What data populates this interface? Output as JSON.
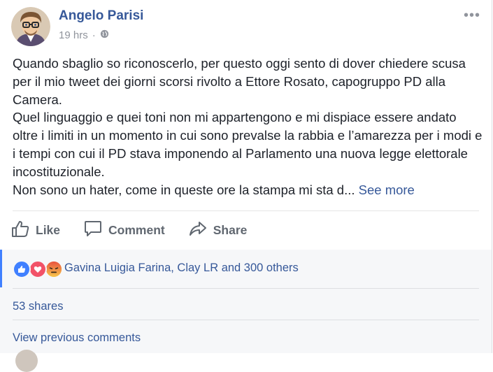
{
  "post": {
    "author": "Angelo Parisi",
    "time": "19 hrs",
    "dot": "·",
    "privacy_icon": "globe-icon",
    "paragraphs": [
      "Quando sbaglio so riconoscerlo, per questo oggi sento di dover chiedere scusa per il mio tweet dei giorni scorsi rivolto a Ettore Rosato, capogruppo PD alla Camera.",
      "Quel linguaggio e quei toni non mi appartengono e mi dispiace essere andato oltre i limiti in un momento in cui sono prevalse la rabbia e l’amarezza per i modi e i tempi con cui il PD stava imponendo al Parlamento una nuova legge elettorale incostituzionale."
    ],
    "truncated_line": "Non sono un hater, come in queste ore la stampa mi sta d...",
    "see_more": "See more"
  },
  "actions": {
    "like": "Like",
    "comment": "Comment",
    "share": "Share"
  },
  "reactions": {
    "icons": [
      "like-icon",
      "love-icon",
      "angry-icon"
    ],
    "names": "Gavina Luigia Farina, Clay LR and 300 others"
  },
  "shares": "53 shares",
  "view_previous": "View previous comments",
  "colors": {
    "link": "#365899",
    "muted": "#90949c",
    "accent": "#4080ff"
  }
}
